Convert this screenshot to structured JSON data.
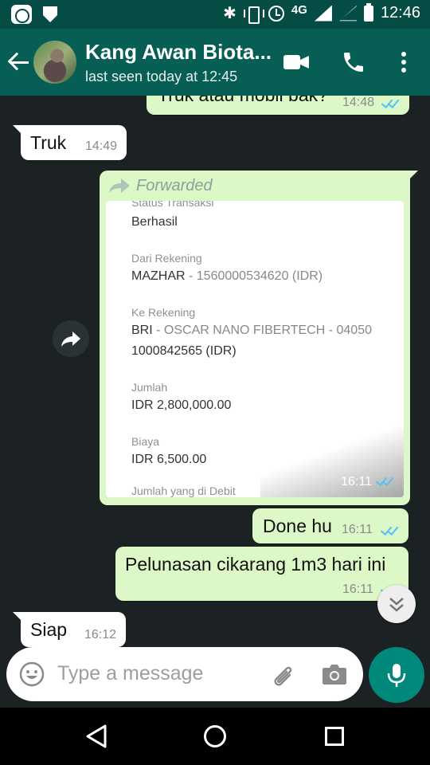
{
  "status_bar": {
    "network": "4G",
    "time": "12:46"
  },
  "header": {
    "contact_name": "Kang Awan Biota...",
    "last_seen": "last seen today at 12:45"
  },
  "messages": [
    {
      "direction": "out",
      "text": "Truk atau mobil bak?",
      "time": "14:48",
      "status": "read"
    },
    {
      "direction": "in",
      "text": "Truk",
      "time": "14:49"
    },
    {
      "direction": "out",
      "forwarded_label": "Forwarded",
      "time": "16:11",
      "status": "read",
      "receipt": {
        "rows": [
          {
            "label": "Status Transaksi",
            "value": "Berhasil"
          },
          {
            "label": "Dari Rekening",
            "value": "MAZHAR",
            "value_soft": " - 1560000534620 (IDR)"
          },
          {
            "label": "Ke Rekening",
            "value": "BRI",
            "value_soft": " - OSCAR NANO FIBERTECH - 04050",
            "value_line2": "1000842565 (IDR)"
          },
          {
            "label": "Jumlah",
            "value": "IDR 2,800,000.00"
          },
          {
            "label": "Biaya",
            "value": "IDR 6,500.00"
          },
          {
            "label": "Jumlah yang di Debit"
          }
        ]
      }
    },
    {
      "direction": "out",
      "text": "Done hu",
      "time": "16:11",
      "status": "read"
    },
    {
      "direction": "out",
      "text": "Pelunasan cikarang 1m3 hari ini",
      "time": "16:11",
      "status": "read"
    },
    {
      "direction": "in",
      "text": "Siap",
      "time": "16:12"
    }
  ],
  "composer": {
    "placeholder": "Type a message"
  },
  "colors": {
    "header": "#075e54",
    "status_bar": "#054d44",
    "outgoing_bubble": "#dcf8c6",
    "incoming_bubble": "#ffffff",
    "read_ticks": "#4fc3f7",
    "mic_button": "#00897b",
    "chat_background": "#1c2124"
  },
  "icons": [
    "back-arrow-icon",
    "video-call-icon",
    "phone-icon",
    "more-options-icon",
    "forward-icon",
    "share-icon",
    "scroll-down-icon",
    "emoji-icon",
    "attach-icon",
    "camera-icon",
    "mic-icon",
    "nav-back-icon",
    "nav-home-icon",
    "nav-recents-icon"
  ]
}
